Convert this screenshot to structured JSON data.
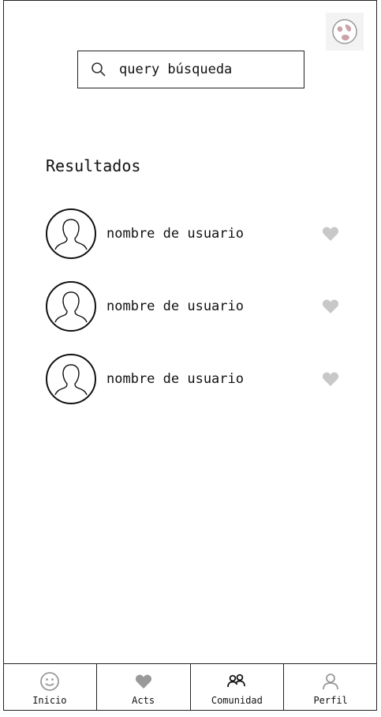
{
  "search": {
    "query": "query búsqueda"
  },
  "results_title": "Resultados",
  "results": [
    {
      "username": "nombre de usuario"
    },
    {
      "username": "nombre de usuario"
    },
    {
      "username": "nombre de usuario"
    }
  ],
  "tabs": [
    {
      "label": "Inicio",
      "icon": "smiley-icon"
    },
    {
      "label": "Acts",
      "icon": "heart-icon"
    },
    {
      "label": "Comunidad",
      "icon": "community-icon"
    },
    {
      "label": "Perfil",
      "icon": "profile-icon"
    }
  ],
  "colors": {
    "border": "#222222",
    "icon_gray": "#aaaaaa",
    "heart_gray": "#c8c8c8"
  }
}
